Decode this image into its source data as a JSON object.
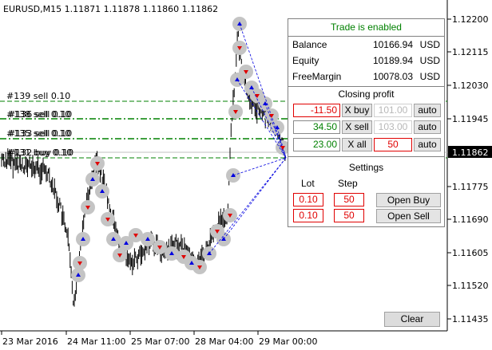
{
  "chart": {
    "symbol_info": "EURUSD,M15  1.11871 1.11878 1.11860 1.11862",
    "current_price": "1.11862",
    "price_ticks": [
      "1.12200",
      "1.12115",
      "1.12030",
      "1.11945",
      "1.11862",
      "1.11775",
      "1.11690",
      "1.11605",
      "1.11520",
      "1.11435"
    ],
    "time_ticks": [
      "23 Mar 2016",
      "24 Mar 11:00",
      "25 Mar 07:00",
      "28 Mar 04:00",
      "29 Mar 00:00"
    ],
    "order_labels": [
      "#139 sell 0.10",
      "#136 sell 0.10",
      "#133 sell 0.10",
      "#132 buy 0.10"
    ],
    "overlap_labels": [
      "#138 sell 0.10",
      "#135 sell 0.10",
      "#134 sell 0.10",
      "#131 buy 0.10"
    ],
    "colors": {
      "sell_arrow": "#e00000",
      "buy_arrow": "#0000e0",
      "order_line": "#008000",
      "bid_line": "#c0c0c0"
    }
  },
  "panel": {
    "status": "Trade is enabled",
    "status_color": "#008000",
    "account": [
      {
        "label": "Balance",
        "value": "10166.94",
        "currency": "USD"
      },
      {
        "label": "Equity",
        "value": "10189.94",
        "currency": "USD"
      },
      {
        "label": "FreeMargin",
        "value": "10078.03",
        "currency": "USD"
      }
    ],
    "closing_title": "Closing profit",
    "closing": [
      {
        "profit": "-11.50",
        "button": "X buy",
        "target": "101.00",
        "auto": "auto"
      },
      {
        "profit": "34.50",
        "button": "X sell",
        "target": "103.00",
        "auto": "auto"
      },
      {
        "profit": "23.00",
        "button": "X all",
        "target": "50",
        "auto": "auto"
      }
    ],
    "settings_title": "Settings",
    "lot_label": "Lot",
    "step_label": "Step",
    "orders": [
      {
        "lot": "0.10",
        "step": "50",
        "button": "Open Buy"
      },
      {
        "lot": "0.10",
        "step": "50",
        "button": "Open Sell"
      }
    ]
  },
  "clear_button": "Clear"
}
